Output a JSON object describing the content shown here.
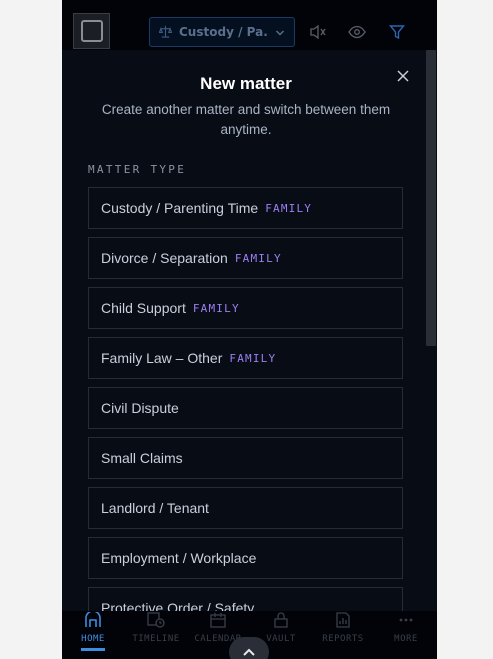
{
  "topbar": {
    "matter_select_value": "Custody / Pa...",
    "icons": [
      "scale-icon",
      "chevron-down-icon",
      "mute-icon",
      "eye-icon",
      "filter-icon"
    ]
  },
  "modal": {
    "title": "New matter",
    "subtitle": "Create another matter and switch between them anytime.",
    "section_label": "MATTER TYPE",
    "types": [
      {
        "label": "Custody / Parenting Time",
        "tag": "FAMILY"
      },
      {
        "label": "Divorce / Separation",
        "tag": "FAMILY"
      },
      {
        "label": "Child Support",
        "tag": "FAMILY"
      },
      {
        "label": "Family Law – Other",
        "tag": "FAMILY"
      },
      {
        "label": "Civil Dispute",
        "tag": ""
      },
      {
        "label": "Small Claims",
        "tag": ""
      },
      {
        "label": "Landlord / Tenant",
        "tag": ""
      },
      {
        "label": "Employment / Workplace",
        "tag": ""
      },
      {
        "label": "Protective Order / Safety",
        "tag": ""
      }
    ]
  },
  "nav": {
    "items": [
      {
        "label": "HOME",
        "icon": "home-icon",
        "active": true
      },
      {
        "label": "TIMELINE",
        "icon": "timeline-icon",
        "active": false
      },
      {
        "label": "CALENDAR",
        "icon": "calendar-icon",
        "active": false
      },
      {
        "label": "VAULT",
        "icon": "vault-icon",
        "active": false
      },
      {
        "label": "REPORTS",
        "icon": "reports-icon",
        "active": false
      },
      {
        "label": "MORE",
        "icon": "more-icon",
        "active": false
      }
    ]
  },
  "colors": {
    "accent": "#3c8ce0",
    "tag": "#9d7ff5",
    "panel": "#080c14",
    "border": "#262b35"
  }
}
